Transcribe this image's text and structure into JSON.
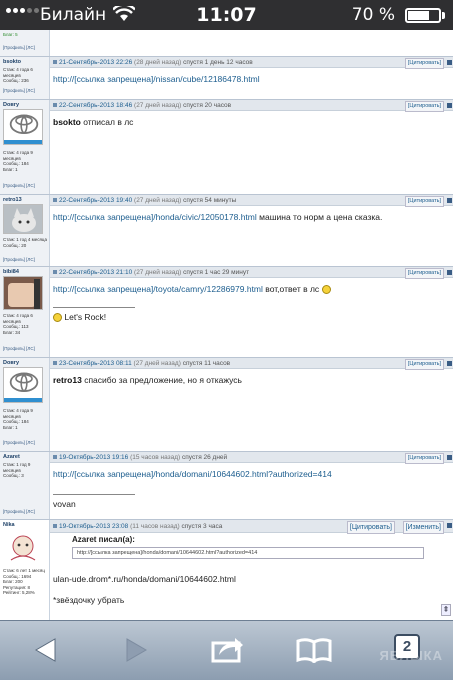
{
  "status": {
    "carrier": "Билайн",
    "time": "11:07",
    "battery": "70 %",
    "battery_level": 0.7
  },
  "top_fragment": {
    "meta": "Благ: 5",
    "links": "[Профиль] [ЛС]"
  },
  "posts": [
    {
      "user": "bsokto",
      "meta": "Стаж: 4 года 6 месяцев\nСообщ.: 236",
      "links": "[Профиль] [ЛС]",
      "date": "21-Сентябрь-2013 22:26",
      "ago": "(28 дней назад)",
      "after": "спустя 1 день 12 часов",
      "quote_btn": "[Цитировать]",
      "link": "http://[ссылка запрещена]/nissan/cube/12186478.html",
      "text": ""
    },
    {
      "user": "Dовгу",
      "meta": "Стаж: 4 года 9 месяцев\nСообщ.: 184\nБлаг: 1",
      "links": "[Профиль] [ЛС]",
      "badge": "ЗАПЧАСТИ",
      "date": "22-Сентябрь-2013 18:46",
      "ago": "(27 дней назад)",
      "after": "спустя 20 часов",
      "quote_btn": "[Цитировать]",
      "bold": "bsokto",
      "text": " отписал в лс"
    },
    {
      "user": "retro13",
      "meta": "Стаж: 1 год 4 месяца\nСообщ.: 20",
      "links": "[Профиль] [ЛС]",
      "date": "22-Сентябрь-2013 19:40",
      "ago": "(27 дней назад)",
      "after": "спустя 54 минуты",
      "quote_btn": "[Цитировать]",
      "link": "http://[ссылка запрещена]/honda/civic/12050178.html",
      "text": " машина то норм а цена сказка."
    },
    {
      "user": "bibi84",
      "meta": "Стаж: 4 года 6 месяцев\nСообщ.: 113\nБлаг: 34",
      "links": "[Профиль] [ЛС]",
      "date": "22-Сентябрь-2013 21:10",
      "ago": "(27 дней назад)",
      "after": "спустя 1 час 29 минут",
      "quote_btn": "[Цитировать]",
      "link": "http://[ссылка запрещена]/toyota/camry/12286979.html",
      "text": " вот,ответ в лс",
      "signature": "Let's Rock!"
    },
    {
      "user": "Dовгу",
      "meta": "Стаж: 4 года 9 месяцев\nСообщ.: 184\nБлаг: 1",
      "links": "[Профиль] [ЛС]",
      "badge": "ЗАПЧАСТИ",
      "date": "23-Сентябрь-2013 08:11",
      "ago": "(27 дней назад)",
      "after": "спустя 11 часов",
      "quote_btn": "[Цитировать]",
      "bold": "retro13",
      "text": " спасибо за предложение, но я откажусь"
    },
    {
      "user": "Azaret",
      "meta": "Стаж: 1 год 9 месяцев\nСообщ.: 3",
      "links": "[Профиль] [ЛС]",
      "date": "19-Октябрь-2013 19:16",
      "ago": "(15 часов назад)",
      "after": "спустя 26 дней",
      "quote_btn": "[Цитировать]",
      "link": "http://[ссылка запрещена]/honda/domani/10644602.html?authorized=414",
      "text": "",
      "signature": "vovan"
    },
    {
      "user": "Nika",
      "meta": "Стаж: 6 лет 1 месяц\nСообщ.: 1694\nБлаг: 200\nРепутация: 8\nРейтинг: 5,28%",
      "date": "19-Октябрь-2013 23:08",
      "ago": "(11 часов назад)",
      "after": "спустя 3 часа",
      "quote_btn": "[Цитировать]",
      "edit_btn": "[Изменить]",
      "quote_author": "Azaret писал(а):",
      "quote_text": "http://[ссылка запрещена]/honda/domani/10644602.html?authorized=414",
      "text": "ulan-ude.drom*.ru/honda/domani/10644602.html",
      "text2": "*звёздочку убрать"
    }
  ],
  "toolbar": {
    "tabs_count": "2",
    "watermark": "ЯБЛЫКА"
  },
  "colors": {
    "link": "#1c5d8e",
    "header_bg": "#e2e7ed",
    "toolbar": "#a9b7c6"
  }
}
